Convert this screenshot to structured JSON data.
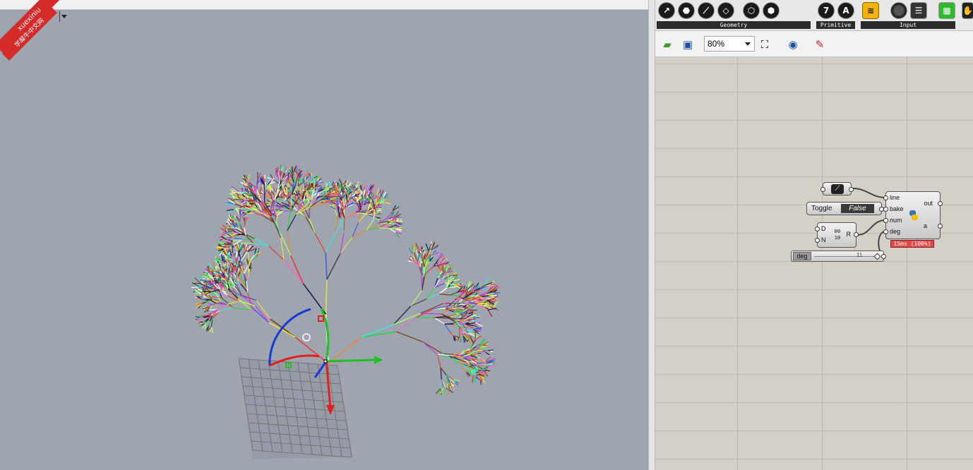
{
  "viewport": {
    "label": "ctive",
    "watermark_top": "xuexiniu",
    "watermark_bottom": "学犀牛中文网"
  },
  "gh": {
    "ribbon": {
      "groups": [
        {
          "label": "Geometry",
          "icons": [
            "curve-param-icon",
            "surface-param-icon",
            "line-param-icon",
            "plane-param-icon",
            "hexagon-param-icon",
            "box-param-icon"
          ]
        },
        {
          "label": "Primitive",
          "icons": [
            "integer-icon",
            "text-icon"
          ]
        },
        {
          "label": "Input",
          "icons": [
            "gradient-icon",
            "button-icon",
            "list-icon"
          ]
        }
      ],
      "primitive_int": "7",
      "primitive_text": "A"
    },
    "toolbar": {
      "zoom": "80%"
    },
    "nodes": {
      "toggle_label": "Toggle",
      "toggle_value": "False",
      "deg_input_d": "D",
      "deg_input_n": "N",
      "deg_output_r": "R",
      "deg_icon_top": "00",
      "deg_icon_bottom": "10",
      "slider_label": "deg",
      "slider_value": "11",
      "py_inputs": [
        "line",
        "bake",
        "num",
        "deg"
      ],
      "py_outputs": [
        "out",
        "a"
      ],
      "py_timer": "15ms (100%)"
    }
  }
}
